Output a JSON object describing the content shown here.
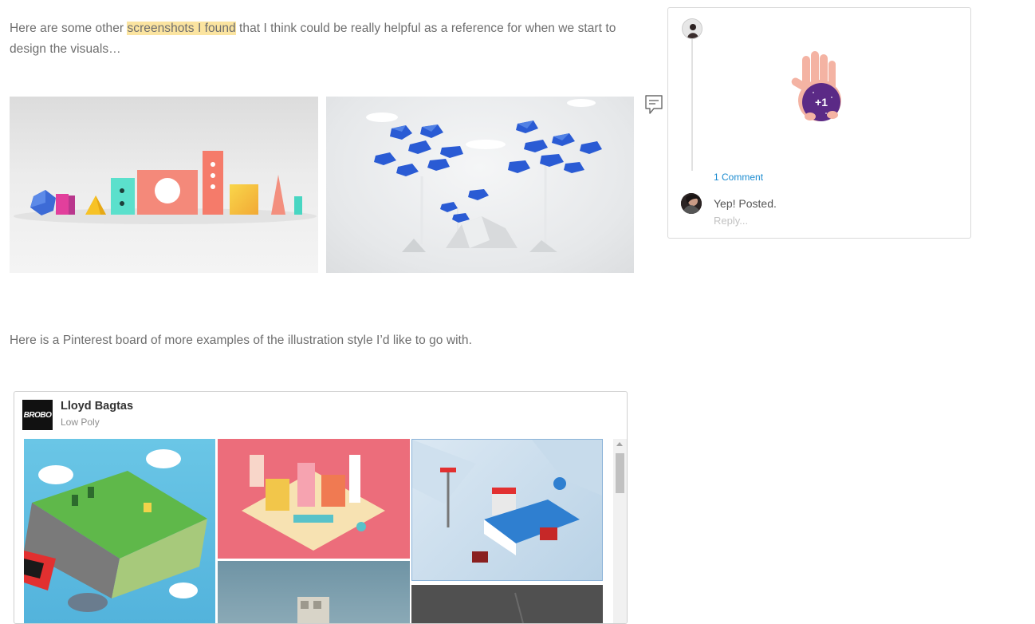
{
  "paragraph1": {
    "before": "Here are some other ",
    "highlight": "screenshots I found",
    "after": " that I think could be really helpful as a reference for when we start to design the visuals…"
  },
  "paragraph2": {
    "text": "Here is a Pinterest board of more examples of the illustration style I’d like to go with."
  },
  "icons": {
    "comment_trigger": "comment-bubble-icon",
    "clap": "clap-hand-icon"
  },
  "comment_panel": {
    "clap_badge": "+1",
    "comment_count": "1 Comment",
    "comment_text": "Yep! Posted.",
    "reply_placeholder": "Reply..."
  },
  "pinterest": {
    "logo_text": "BROBO",
    "user_name": "Lloyd Bagtas",
    "board_name": "Low Poly"
  },
  "colors": {
    "highlight": "#fbe4a0",
    "link": "#1a8bd0",
    "clap_badge": "#5b2a86"
  }
}
